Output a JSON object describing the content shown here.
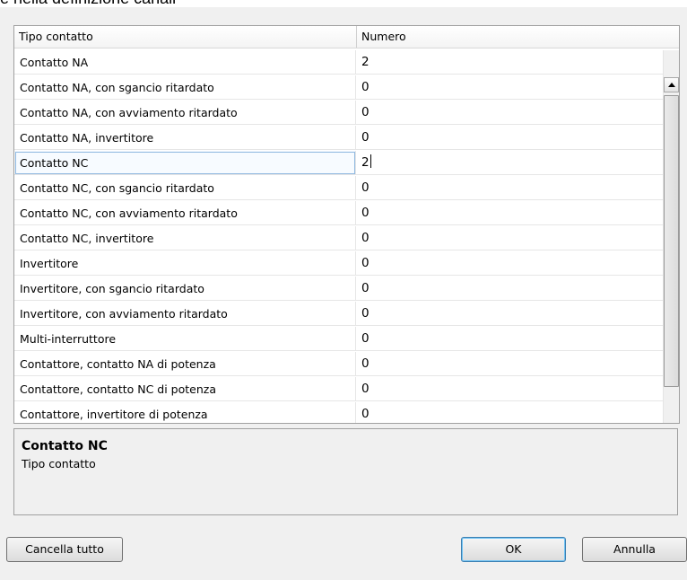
{
  "top_fragment": "e nella definizione canali",
  "table": {
    "columns": [
      "Tipo contatto",
      "Numero"
    ],
    "rows": [
      {
        "name": "Contatto NA",
        "value": "2"
      },
      {
        "name": "Contatto NA, con sgancio ritardato",
        "value": "0"
      },
      {
        "name": "Contatto NA, con avviamento ritardato",
        "value": "0"
      },
      {
        "name": "Contatto NA, invertitore",
        "value": "0"
      },
      {
        "name": "Contatto NC",
        "value": "2"
      },
      {
        "name": "Contatto NC, con sgancio ritardato",
        "value": "0"
      },
      {
        "name": "Contatto NC, con avviamento ritardato",
        "value": "0"
      },
      {
        "name": "Contatto NC, invertitore",
        "value": "0"
      },
      {
        "name": "Invertitore",
        "value": "0"
      },
      {
        "name": "Invertitore, con sgancio ritardato",
        "value": "0"
      },
      {
        "name": "Invertitore, con avviamento ritardato",
        "value": "0"
      },
      {
        "name": "Multi-interruttore",
        "value": "0"
      },
      {
        "name": "Contattore, contatto NA di potenza",
        "value": "0"
      },
      {
        "name": "Contattore, contatto NC di potenza",
        "value": "0"
      },
      {
        "name": "Contattore, invertitore di potenza",
        "value": "0"
      }
    ],
    "selected_row": 4
  },
  "description": {
    "title": "Contatto NC",
    "subtitle": "Tipo contatto"
  },
  "buttons": {
    "clear_all": "Cancella tutto",
    "ok": "OK",
    "cancel": "Annulla"
  },
  "icons": {
    "scroll_up": "chevron-up-icon",
    "scroll_down": "chevron-down-icon"
  }
}
